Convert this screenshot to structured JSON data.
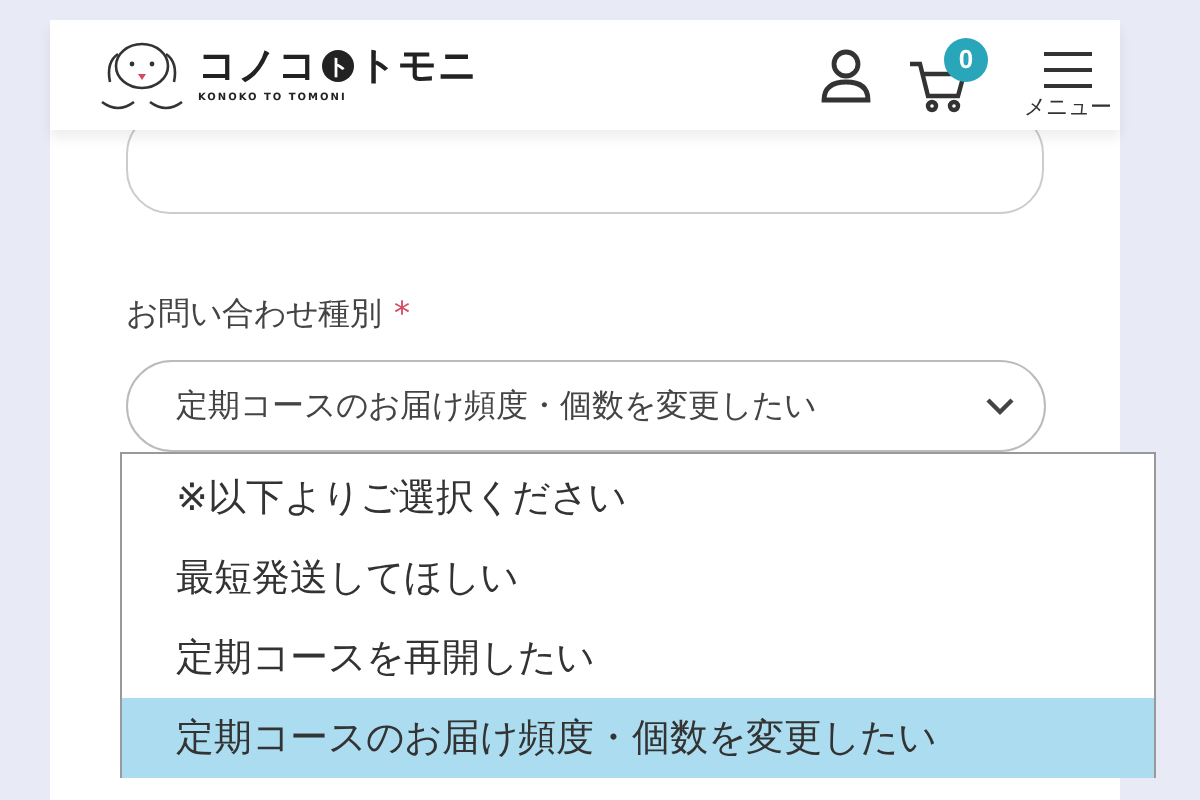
{
  "header": {
    "logo": {
      "parts": [
        "コノコ",
        "ト",
        "トモニ"
      ],
      "subtitle": "KONOKO TO TOMONI"
    },
    "cart_count": "0",
    "menu_label": "メニュー"
  },
  "form": {
    "field_label": "お問い合わせ種別",
    "required_mark": "*",
    "select": {
      "value": "定期コースのお届け頻度・個数を変更したい",
      "expanded": true
    },
    "options": [
      {
        "label": "※以下よりご選択ください",
        "selected": false
      },
      {
        "label": "最短発送してほしい",
        "selected": false
      },
      {
        "label": "定期コースを再開したい",
        "selected": false
      },
      {
        "label": "定期コースのお届け頻度・個数を変更したい",
        "selected": true
      }
    ]
  }
}
